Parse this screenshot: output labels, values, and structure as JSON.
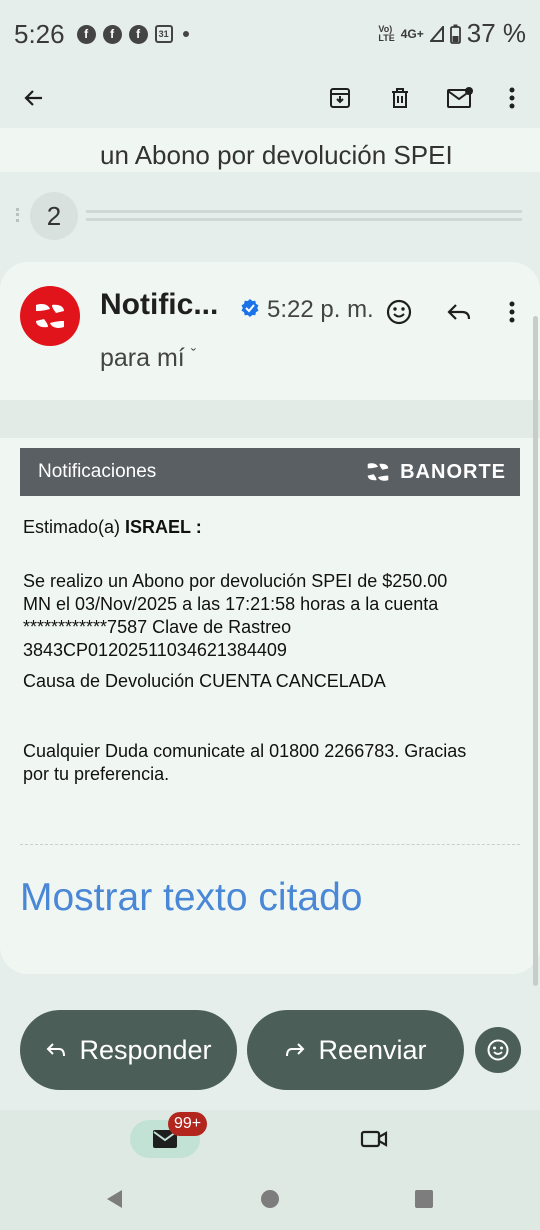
{
  "status_bar": {
    "time": "5:26",
    "notification_icons": [
      "f",
      "f",
      "f"
    ],
    "calendar_label": "31",
    "network_top": "Vo)",
    "network_bottom": "LTE",
    "signal_label": "4G+",
    "battery": "37 %"
  },
  "toolbar": {
    "back_icon": "arrow-back-icon",
    "archive_icon": "archive-icon",
    "delete_icon": "trash-icon",
    "mark_unread_icon": "mark-unread-icon",
    "more_icon": "more-vert-icon"
  },
  "thread": {
    "subject_preview": "un Abono por devolución SPEI",
    "collapsed_count": "2"
  },
  "message": {
    "sender": "Notific...",
    "time": "5:22 p. m.",
    "recipient": "para mí",
    "recipient_chevron": "ˇ",
    "accent_color": "#e1141b"
  },
  "email": {
    "banner_label": "Notificaciones",
    "brand_name": "BANORTE",
    "greeting_prefix": "Estimado(a) ",
    "greeting_name": "ISRAEL :",
    "paragraph_lines": [
      "Se realizo un Abono por devolución SPEI de $250.00",
      "MN el 03/Nov/2025 a las 17:21:58 horas a la cuenta",
      "************7587 Clave de Rastreo",
      "3843CP01202511034621384409"
    ],
    "cause_line": "Causa de Devolución CUENTA CANCELADA",
    "contact_lines": [
      "Cualquier Duda comunicate al 01800 2266783. Gracias",
      "por tu preferencia."
    ],
    "show_quoted": "Mostrar texto citado"
  },
  "actions": {
    "reply_label": "Responder",
    "forward_label": "Reenviar"
  },
  "bottom_nav": {
    "mail_badge": "99+"
  }
}
